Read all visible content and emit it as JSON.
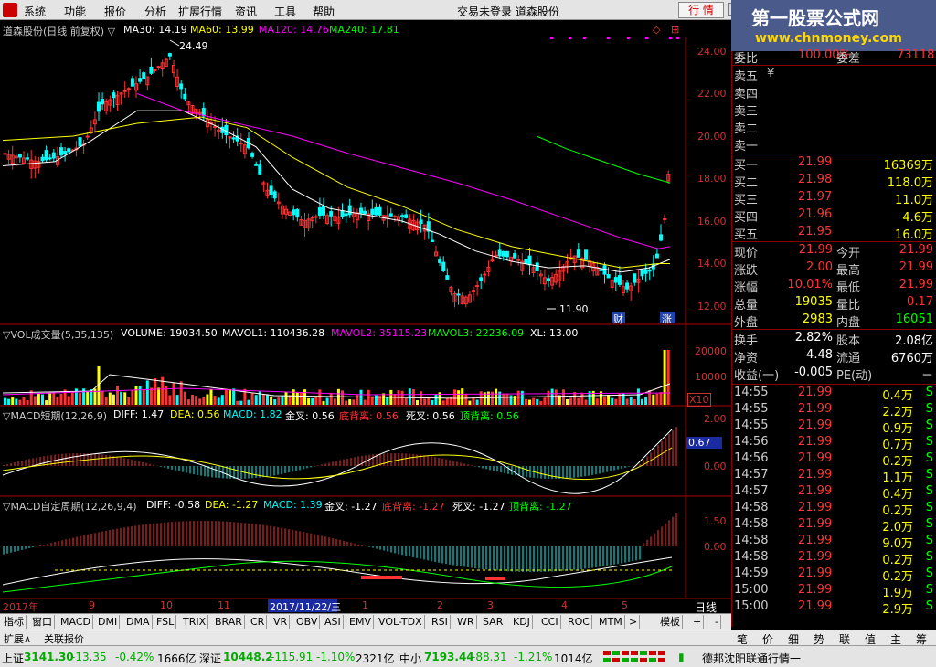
{
  "menubar": {
    "items": [
      "系统",
      "功能",
      "报价",
      "分析",
      "扩展行情",
      "资讯",
      "工具",
      "帮助"
    ],
    "status": "交易未登录  道森股份",
    "quote_button": "行 情"
  },
  "watermark": {
    "title": "第一股票公式网",
    "url": "www.chnmoney.com"
  },
  "kline": {
    "title": "道森股份(日线 前复权) ▽",
    "ma30": "MA30: 14.19",
    "ma60": "MA60: 13.99",
    "ma120": "MA120: 14.76",
    "ma240": "MA240: 17.81",
    "high_mark": "24.49",
    "low_mark": "11.90",
    "marker_cai": "财",
    "marker_zhang": "涨",
    "y_ticks": [
      "24.00",
      "22.00",
      "20.00",
      "18.00",
      "16.00",
      "14.00",
      "12.00"
    ]
  },
  "vol": {
    "title": "▽VOL成交量(5,35,135)",
    "volume": "VOLUME: 19034.50",
    "mavol1": "MAVOL1: 110436.28",
    "mavol2": "MAVOL2: 35115.23",
    "mavol3": "MAVOL3: 22236.09",
    "xl": "XL: 13.00",
    "y_ticks": [
      "20000",
      "10000"
    ],
    "scale": "X10"
  },
  "macd1": {
    "title": "▽MACD短期(12,26,9)",
    "diff": "DIFF: 1.47",
    "dea": "DEA: 0.56",
    "macd": "MACD: 1.82",
    "jincha": "金叉: 0.56",
    "dibeili": "底背离: 0.56",
    "sicha": "死叉: 0.56",
    "dingbeili": "顶背离: 0.56",
    "y_ticks": [
      "2.00",
      "0.00"
    ],
    "cursor_value": "0.67"
  },
  "macd2": {
    "title": "▽MACD自定周期(12,26,9,4)",
    "diff": "DIFF: -0.58",
    "dea": "DEA: -1.27",
    "macd": "MACD: 1.39",
    "jincha": "金叉: -1.27",
    "dibeili": "底背离: -1.27",
    "sicha": "死叉: -1.27",
    "dingbeili": "顶背离: -1.27",
    "y_ticks": [
      "1.50",
      "0.00"
    ]
  },
  "date_axis": {
    "labels": [
      "2017年",
      "9",
      "10",
      "11",
      "2017/11/22/三",
      "1",
      "2",
      "3",
      "4",
      "5"
    ],
    "period": "日线"
  },
  "tabs": [
    "指标",
    "窗口",
    "MACD",
    "DMI",
    "DMA",
    "FSL",
    "TRIX",
    "BRAR",
    "CR",
    "VR",
    "OBV",
    "ASI",
    "EMV",
    "VOL-TDX",
    "RSI",
    "WR",
    "SAR",
    "KDJ",
    "CCI",
    "ROC",
    "MTM",
    ">",
    "模板",
    "+",
    "-"
  ],
  "tabs2": [
    "扩展∧",
    "关联报价"
  ],
  "right_tabs": [
    "笔",
    "价",
    "细",
    "势",
    "联",
    "值",
    "主",
    "筹"
  ],
  "quote": {
    "weibi_label": "委比",
    "weibi": "100.00%",
    "weicha_label": "委差",
    "weicha": "73118",
    "sell": [
      {
        "label": "卖五",
        "mark": "¥"
      },
      {
        "label": "卖四",
        "mark": ""
      },
      {
        "label": "卖三",
        "mark": ""
      },
      {
        "label": "卖二",
        "mark": ""
      },
      {
        "label": "卖一",
        "mark": ""
      }
    ],
    "buy": [
      {
        "label": "买一",
        "price": "21.99",
        "vol": "16369万"
      },
      {
        "label": "买二",
        "price": "21.98",
        "vol": "118.0万"
      },
      {
        "label": "买三",
        "price": "21.97",
        "vol": "11.0万"
      },
      {
        "label": "买四",
        "price": "21.96",
        "vol": "4.6万"
      },
      {
        "label": "买五",
        "price": "21.95",
        "vol": "16.0万"
      }
    ],
    "stats": [
      {
        "l1": "现价",
        "v1": "21.99",
        "l2": "今开",
        "v2": "21.99"
      },
      {
        "l1": "涨跌",
        "v1": "2.00",
        "l2": "最高",
        "v2": "21.99"
      },
      {
        "l1": "涨幅",
        "v1": "10.01%",
        "l2": "最低",
        "v2": "21.99"
      },
      {
        "l1": "总量",
        "v1": "19035",
        "l2": "量比",
        "v2": "0.17"
      },
      {
        "l1": "外盘",
        "v1": "2983",
        "l2": "内盘",
        "v2": "16051"
      }
    ],
    "stats2": [
      {
        "l1": "换手",
        "v1": "2.82%",
        "l2": "股本",
        "v2": "2.08亿"
      },
      {
        "l1": "净资",
        "v1": "4.48",
        "l2": "流通",
        "v2": "6760万"
      },
      {
        "l1": "收益(一)",
        "v1": "-0.005",
        "l2": "PE(动)",
        "v2": "－"
      }
    ],
    "ticks": [
      {
        "t": "14:55",
        "p": "21.99",
        "v": "0.4万",
        "s": "S"
      },
      {
        "t": "14:55",
        "p": "21.99",
        "v": "2.2万",
        "s": "S"
      },
      {
        "t": "14:55",
        "p": "21.99",
        "v": "0.9万",
        "s": "S"
      },
      {
        "t": "14:56",
        "p": "21.99",
        "v": "0.7万",
        "s": "S"
      },
      {
        "t": "14:56",
        "p": "21.99",
        "v": "0.2万",
        "s": "S"
      },
      {
        "t": "14:57",
        "p": "21.99",
        "v": "1.1万",
        "s": "S"
      },
      {
        "t": "14:57",
        "p": "21.99",
        "v": "0.4万",
        "s": "S"
      },
      {
        "t": "14:58",
        "p": "21.99",
        "v": "0.2万",
        "s": "S"
      },
      {
        "t": "14:58",
        "p": "21.99",
        "v": "2.0万",
        "s": "S"
      },
      {
        "t": "14:58",
        "p": "21.99",
        "v": "9.0万",
        "s": "S"
      },
      {
        "t": "14:58",
        "p": "21.99",
        "v": "0.2万",
        "s": "S"
      },
      {
        "t": "14:59",
        "p": "21.99",
        "v": "0.2万",
        "s": "S"
      },
      {
        "t": "15:00",
        "p": "21.99",
        "v": "1.9万",
        "s": "S"
      },
      {
        "t": "15:00",
        "p": "21.99",
        "v": "2.9万",
        "s": "S"
      }
    ]
  },
  "statusbar": {
    "sh_label": "上证",
    "sh_val": "3141.30",
    "sh_chg": "-13.35",
    "sh_pct": "-0.42%",
    "sh_amt": "1666亿",
    "sz_label": "深证",
    "sz_val": "10448.2",
    "sz_chg": "-115.91",
    "sz_pct": "-1.10%",
    "sz_amt": "2321亿",
    "zx_label": "中小",
    "zx_val": "7193.44",
    "zx_chg": "-88.31",
    "zx_pct": "-1.21%",
    "zx_amt": "1014亿",
    "server": "德邦沈阳联通行情一"
  },
  "colors": {
    "up": "#ff3232",
    "down": "#00ffff",
    "ma30": "#ffffff",
    "ma60": "#ffff00",
    "ma120": "#ff00ff",
    "ma240": "#00ff00"
  }
}
